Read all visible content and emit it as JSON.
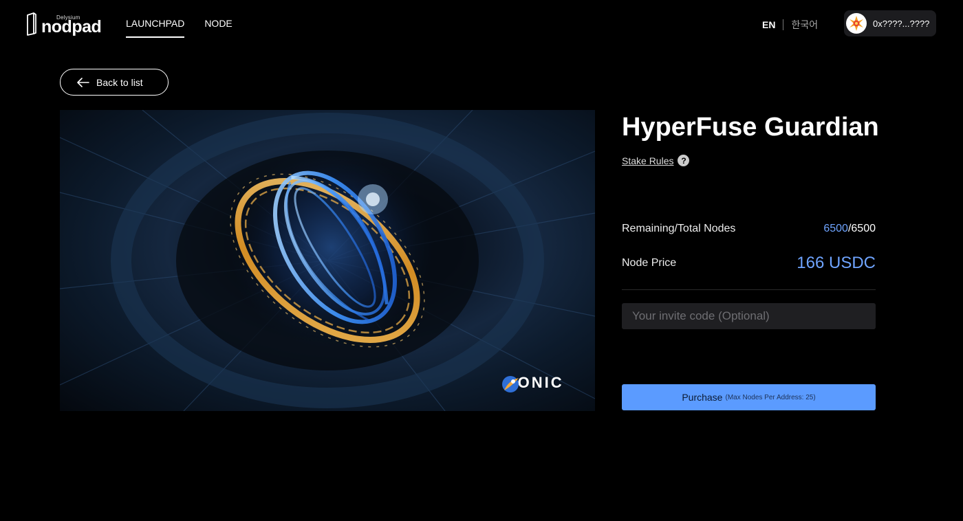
{
  "header": {
    "logo_small": "Delysium",
    "logo_big": "nodpad",
    "nav": [
      {
        "label": "LAUNCHPAD",
        "active": true
      },
      {
        "label": "NODE",
        "active": false
      }
    ],
    "lang_en": "EN",
    "lang_ko": "한국어",
    "wallet_address": "0x????...????"
  },
  "back_label": "Back to list",
  "hero": {
    "brand_text": "SONIC",
    "brand_icon": "sonic-logo-icon"
  },
  "product": {
    "title": "HyperFuse Guardian",
    "stake_rules_label": "Stake Rules",
    "nodes_label": "Remaining/Total Nodes",
    "nodes_remaining": "6500",
    "nodes_separator": "/",
    "nodes_total": "6500",
    "price_label": "Node Price",
    "price_value": "166 USDC",
    "invite_placeholder": "Your invite code (Optional)",
    "purchase_label": "Purchase",
    "purchase_note": "(Max Nodes Per Address: 25)"
  },
  "colors": {
    "accent": "#5b9bff",
    "accent_text": "#6fa4ff",
    "background": "#000000",
    "input_bg": "#1f1f22"
  }
}
